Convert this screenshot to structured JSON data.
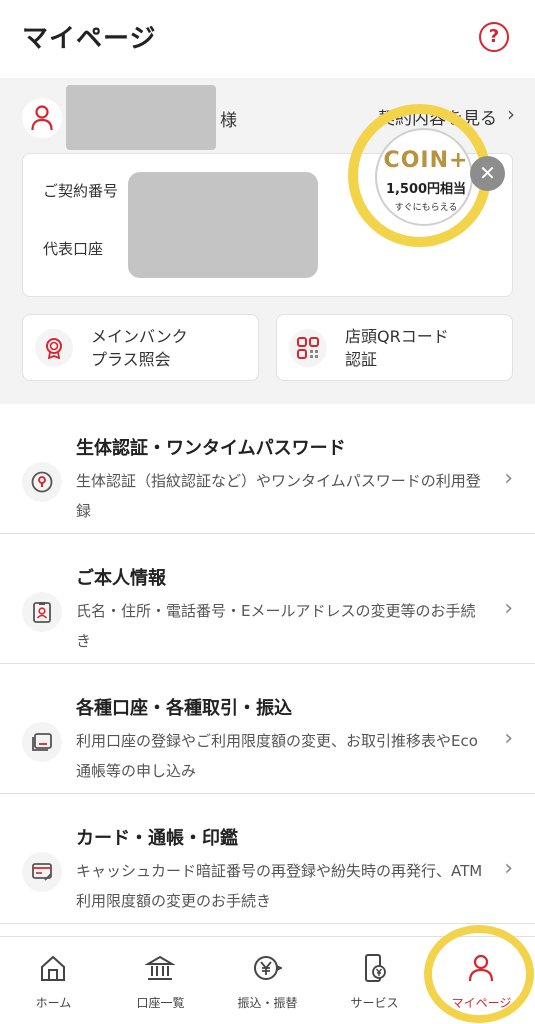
{
  "header": {
    "title": "マイページ",
    "help_icon": "?"
  },
  "user": {
    "honorific": "様",
    "contract_link": "契約内容を見る",
    "chevron": "›"
  },
  "account_card": {
    "account_number_label": "ご契約番号",
    "representative_label": "代表口座"
  },
  "coin_promo": {
    "logo": "COIN+",
    "amount": "1,500円相当",
    "subtext": "すぐにもらえる",
    "close": "✕"
  },
  "quick_actions": [
    {
      "label": "メインバンク\nプラス照会",
      "icon": "ribbon-badge-icon"
    },
    {
      "label": "店頭QRコード\n認証",
      "icon": "qr-code-icon"
    }
  ],
  "menu": [
    {
      "title": "生体認証・ワンタイムパスワード",
      "desc": "生体認証（指紋認証など）やワンタイムパスワードの利用登録",
      "icon": "lock-icon"
    },
    {
      "title": "ご本人情報",
      "desc": "氏名・住所・電話番号・Eメールアドレスの変更等のお手続き",
      "icon": "id-badge-icon"
    },
    {
      "title": "各種口座・各種取引・振込",
      "desc": "利用口座の登録やご利用限度額の変更、お取引推移表やEco通帳等の申し込み",
      "icon": "passbook-icon"
    },
    {
      "title": "カード・通帳・印鑑",
      "desc": "キャッシュカード暗証番号の再登録や紛失時の再発行、ATM利用限度額の変更のお手続き",
      "icon": "card-icon"
    }
  ],
  "bottom_nav": [
    {
      "label": "ホーム",
      "icon": "home-icon"
    },
    {
      "label": "口座一覧",
      "icon": "bank-icon"
    },
    {
      "label": "振込・振替",
      "icon": "yen-transfer-icon"
    },
    {
      "label": "サービス",
      "icon": "phone-yen-icon"
    },
    {
      "label": "マイページ",
      "icon": "person-icon",
      "active": true
    }
  ],
  "colors": {
    "accent": "#d7262f",
    "highlight": "#f2d34a",
    "background_gray": "#f3f3f3"
  }
}
